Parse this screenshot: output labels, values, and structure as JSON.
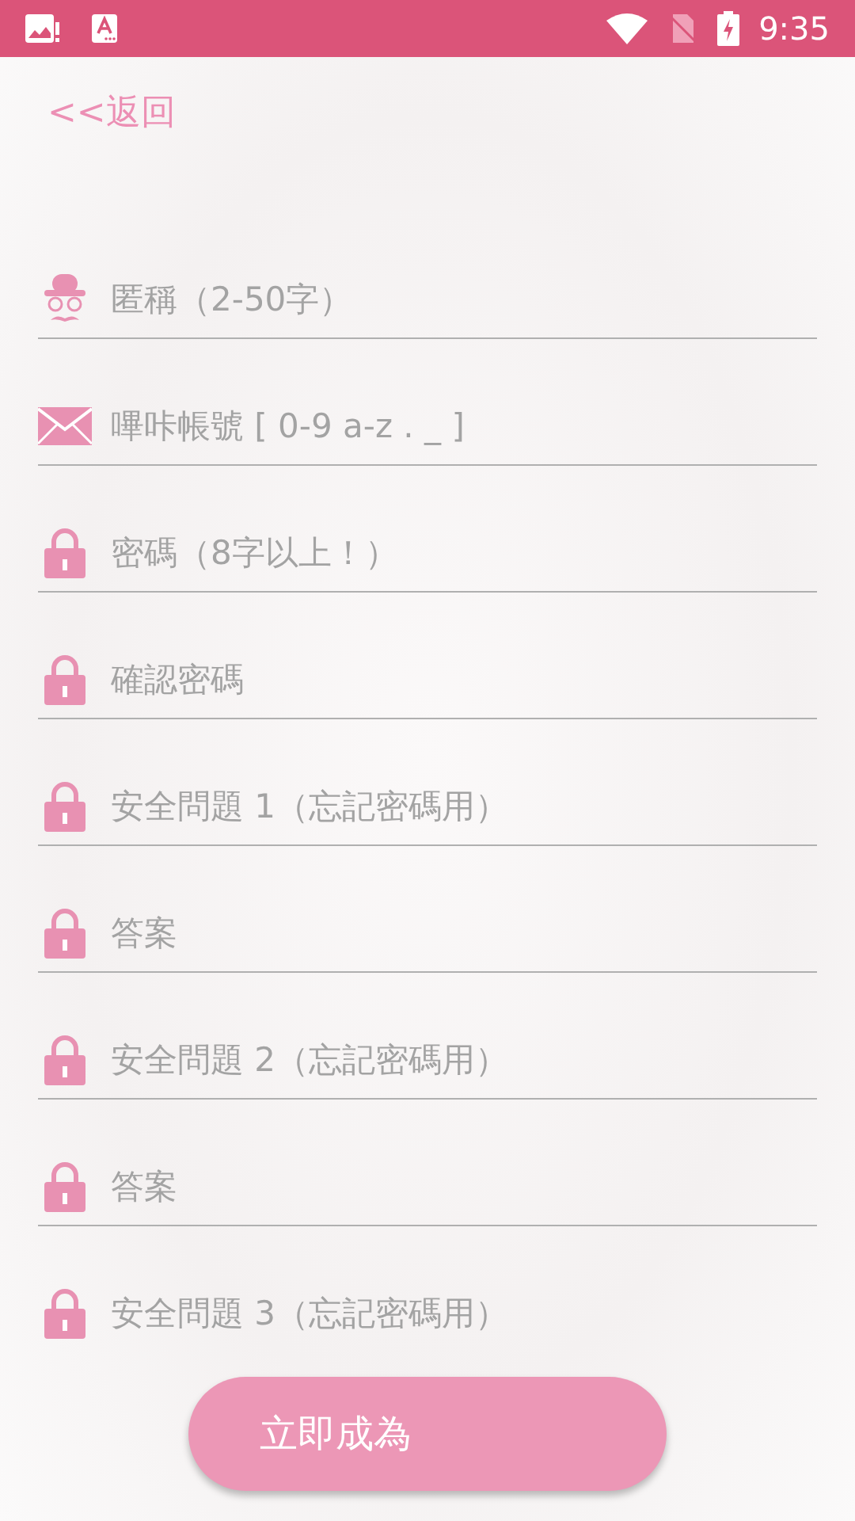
{
  "status_bar": {
    "time": "9:35"
  },
  "back_link": "<<返回",
  "fields": [
    {
      "kind": "user",
      "placeholder": "匿稱（2-50字）"
    },
    {
      "kind": "mail",
      "placeholder": "嗶咔帳號 [ 0-9 a-z . _ ]"
    },
    {
      "kind": "lock",
      "placeholder": "密碼（8字以上！）"
    },
    {
      "kind": "lock",
      "placeholder": "確認密碼"
    },
    {
      "kind": "lock",
      "placeholder": "安全問題 1（忘記密碼用）"
    },
    {
      "kind": "lock",
      "placeholder": "答案"
    },
    {
      "kind": "lock",
      "placeholder": "安全問題 2（忘記密碼用）"
    },
    {
      "kind": "lock",
      "placeholder": "答案"
    },
    {
      "kind": "lock",
      "placeholder": "安全問題 3（忘記密碼用）"
    }
  ],
  "submit_button": "立即成為"
}
